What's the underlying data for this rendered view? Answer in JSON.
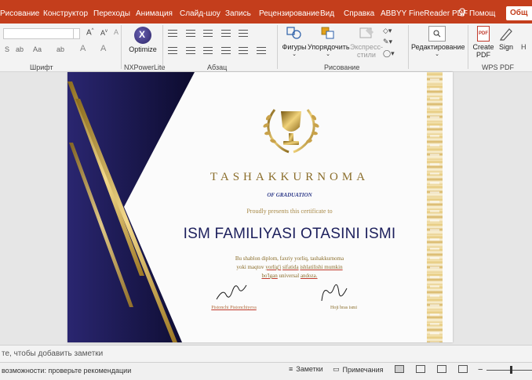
{
  "menu": {
    "tabs": [
      "Рисование",
      "Конструктор",
      "Переходы",
      "Анимация",
      "Слайд-шоу",
      "Запись",
      "Рецензирование",
      "Вид",
      "Справка",
      "ABBYY FineReader PDF"
    ],
    "help": "Помощ",
    "share": "Общ"
  },
  "ribbon": {
    "groups": {
      "font": "Шрифт",
      "nxpowerlite": "NXPowerLite",
      "paragraph": "Абзац",
      "drawing": "Рисование",
      "wps_pdf": "WPS PDF"
    },
    "buttons": {
      "optimize": "Optimize",
      "shapes": "Фигуры",
      "arrange": "Упорядочить",
      "express_styles": "Экспресс-стили",
      "editing": "Редактирование",
      "create_pdf": "Create PDF",
      "sign": "Sign"
    }
  },
  "slide": {
    "title": "TASHAKKURNOMA",
    "subtitle": "OF GRADUATION",
    "presents": "Proudly presents this certificate to",
    "recipient": "ISM FAMILIYASI OTASINI ISMI",
    "body_line1": "Bu shablon diplom, faxriy yorliq, tashakkurnoma",
    "body_line2_a": "yoki maqtov ",
    "body_line2_b": "yorlig'i",
    "body_line2_c": " ",
    "body_line2_d": "sifatida",
    "body_line2_e": " ",
    "body_line2_f": "ishlatilishi mumkin",
    "body_line3_a": "bo'lgan",
    "body_line3_b": " universal ",
    "body_line3_c": "andoza.",
    "signer1": "Pistonchi Pistonchiyeva",
    "signer2": "Hoji bras ismi"
  },
  "notes_placeholder": "те, чтобы добавить заметки",
  "status": {
    "accessibility": "возможности: проверьте рекомендации",
    "notes": "Заметки",
    "comments": "Примечания"
  },
  "colors": {
    "accent": "#c43e1c",
    "navy": "#1c1f5c",
    "gold": "#c9a24a"
  }
}
